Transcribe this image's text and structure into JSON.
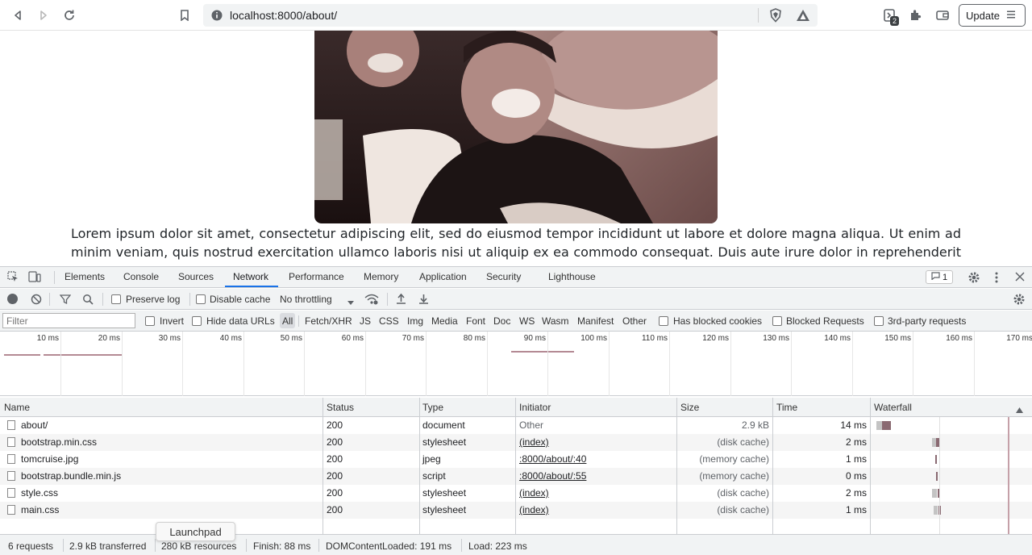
{
  "browser": {
    "url": "localhost:8000/about/",
    "update_label": "Update",
    "extension_badge": "2"
  },
  "page": {
    "paragraph": "Lorem ipsum dolor sit amet, consectetur adipiscing elit, sed do eiusmod tempor incididunt ut labore et dolore magna aliqua. Ut enim ad minim veniam, quis nostrud exercitation ullamco laboris nisi ut aliquip ex ea commodo consequat. Duis aute irure dolor in reprehenderit"
  },
  "devtools": {
    "tabs": [
      "Elements",
      "Console",
      "Sources",
      "Network",
      "Performance",
      "Memory",
      "Application",
      "Security",
      "Lighthouse"
    ],
    "active_tab": "Network",
    "issues_count": "1",
    "toolbar": {
      "preserve_log": "Preserve log",
      "disable_cache": "Disable cache",
      "throttling": "No throttling"
    },
    "filter": {
      "placeholder": "Filter",
      "invert": "Invert",
      "hide_data_urls": "Hide data URLs",
      "types": [
        "All",
        "Fetch/XHR",
        "JS",
        "CSS",
        "Img",
        "Media",
        "Font",
        "Doc",
        "WS",
        "Wasm",
        "Manifest",
        "Other"
      ],
      "has_blocked_cookies": "Has blocked cookies",
      "blocked_requests": "Blocked Requests",
      "third_party": "3rd-party requests"
    },
    "overview_ticks": [
      "10 ms",
      "20 ms",
      "30 ms",
      "40 ms",
      "50 ms",
      "60 ms",
      "70 ms",
      "80 ms",
      "90 ms",
      "100 ms",
      "110 ms",
      "120 ms",
      "130 ms",
      "140 ms",
      "150 ms",
      "160 ms",
      "170 ms"
    ],
    "columns": {
      "name": "Name",
      "status": "Status",
      "type": "Type",
      "initiator": "Initiator",
      "size": "Size",
      "time": "Time",
      "waterfall": "Waterfall"
    },
    "requests": [
      {
        "name": "about/",
        "status": "200",
        "type": "document",
        "initiator": "Other",
        "size": "2.9 kB",
        "time": "14 ms"
      },
      {
        "name": "bootstrap.min.css",
        "status": "200",
        "type": "stylesheet",
        "initiator": "(index)",
        "size": "(disk cache)",
        "time": "2 ms"
      },
      {
        "name": "tomcruise.jpg",
        "status": "200",
        "type": "jpeg",
        "initiator": ":8000/about/:40",
        "size": "(memory cache)",
        "time": "1 ms"
      },
      {
        "name": "bootstrap.bundle.min.js",
        "status": "200",
        "type": "script",
        "initiator": ":8000/about/:55",
        "size": "(memory cache)",
        "time": "0 ms"
      },
      {
        "name": "style.css",
        "status": "200",
        "type": "stylesheet",
        "initiator": "(index)",
        "size": "(disk cache)",
        "time": "2 ms"
      },
      {
        "name": "main.css",
        "status": "200",
        "type": "stylesheet",
        "initiator": "(index)",
        "size": "(disk cache)",
        "time": "1 ms"
      }
    ],
    "status": {
      "requests": "6 requests",
      "transferred": "2.9 kB transferred",
      "resources": "280 kB resources",
      "finish": "Finish: 88 ms",
      "dcl": "DOMContentLoaded: 191 ms",
      "load": "Load: 223 ms"
    },
    "tooltip": "Launchpad"
  }
}
